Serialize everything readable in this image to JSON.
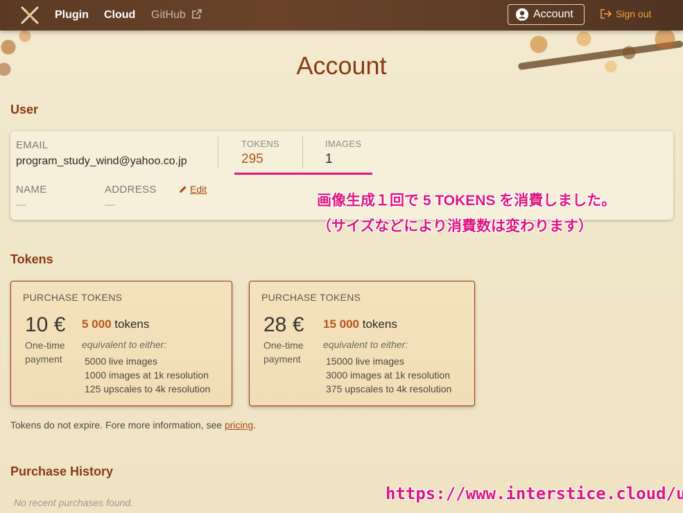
{
  "nav": {
    "plugin": "Plugin",
    "cloud": "Cloud",
    "github": "GitHub",
    "account": "Account",
    "sign_out": "Sign out"
  },
  "page_title": "Account",
  "user_section": {
    "heading": "User",
    "email_label": "EMAIL",
    "email_value": "program_study_wind@yahoo.co.jp",
    "tokens_label": "TOKENS",
    "tokens_value": "295",
    "images_label": "IMAGES",
    "images_value": "1",
    "name_label": "NAME",
    "name_value": "—",
    "address_label": "ADDRESS",
    "address_value": "—",
    "edit": "Edit"
  },
  "annotations": {
    "line1": "画像生成１回で 5 TOKENS を消費しました。",
    "line2": "（サイズなどにより消費数は変わります）",
    "url": "https://www.interstice.cloud/user"
  },
  "tokens_section": {
    "heading": "Tokens",
    "cards": [
      {
        "label": "PURCHASE TOKENS",
        "price": "10 €",
        "payment": "One-time payment",
        "amount": "5 000",
        "unit": "tokens",
        "equivalent": "equivalent to either:",
        "items": [
          "5000 live images",
          "1000 images at 1k resolution",
          "125 upscales to 4k resolution"
        ]
      },
      {
        "label": "PURCHASE TOKENS",
        "price": "28 €",
        "payment": "One-time payment",
        "amount": "15 000",
        "unit": "tokens",
        "equivalent": "equivalent to either:",
        "items": [
          "15000 live images",
          "3000 images at 1k resolution",
          "375 upscales to 4k resolution"
        ]
      }
    ],
    "note_prefix": "Tokens do not expire. Fore more information, see ",
    "note_link": "pricing",
    "note_suffix": "."
  },
  "purchase_history": {
    "heading": "Purchase History",
    "empty": "No recent purchases found."
  },
  "colors": {
    "accent": "#8a3a14",
    "tokens": "#b5561a",
    "annotation": "#e0157e",
    "card_border": "#a0301c"
  }
}
